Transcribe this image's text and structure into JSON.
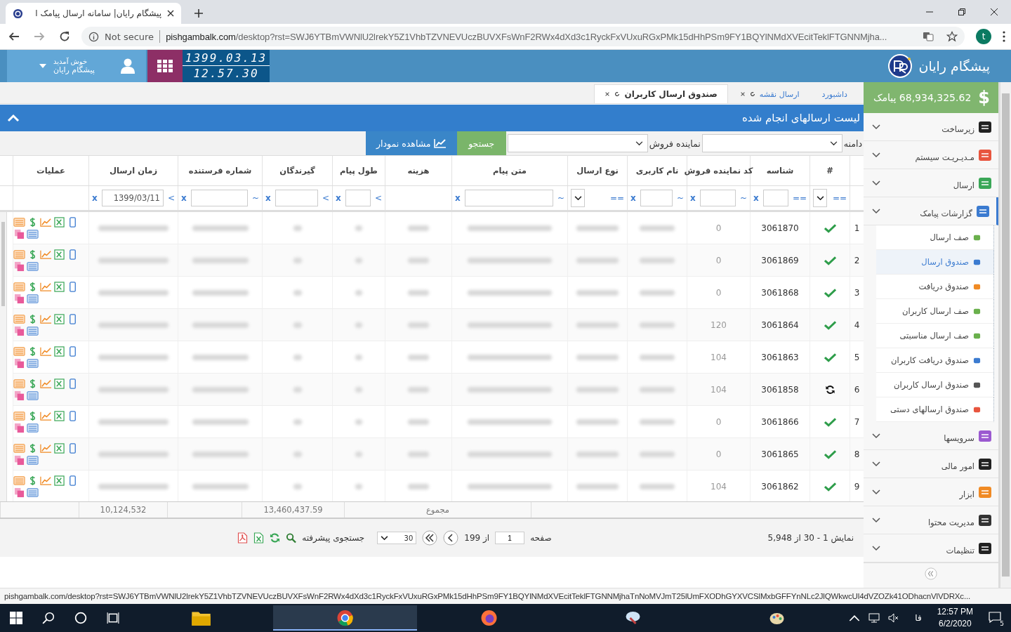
{
  "browser": {
    "tab_title": "پیشگام رایان| سامانه ارسال پیامک ا",
    "not_secure": "Not secure",
    "url_host": "pishgambalk.com",
    "url_path": "/desktop?rst=SWJ6YTBmVWNlU2lrekY5Z1VhbTZVNEVUczBUVXFsWnF2RWx4dXd3c1RyckFxVUxuRGxPMk15dHhPSm9FY1BQYlNMdXVEcitTeklFTGNNMjha...",
    "profile": "t",
    "status_url": "pishgambalk.com/desktop?rst=SWJ6YTBmVWNlU2lrekY5Z1VhbTZVNEVUczBUVXFsWnF2RWx4dXd3c1RyckFxVUxuRGxPMk15dHhPSm9FY1BQYlNMdXVEcitTeklFTGNNMjhaTnNoMVJmT25lUmFXODhGYXVCSlMxbGFFYnNLc2JlQWkwcUl4dVZOZk41ODhacnVlVDRXc..."
  },
  "header": {
    "brand": "پیشگام رایان",
    "date": "1399.03.13",
    "time": "12.57.30",
    "welcome": "خوش آمدید",
    "user_name": "پیشگام رایان"
  },
  "sidebar": {
    "balance_icon": "$",
    "balance": "68,934,325.62 پیامک",
    "items": [
      {
        "label": "زیرساخت",
        "expanded": false
      },
      {
        "label": "مـدیـریـت سیستم",
        "expanded": false
      },
      {
        "label": "ارسال",
        "expanded": false
      },
      {
        "label": "گزارشات پیامک",
        "expanded": true,
        "children": [
          {
            "label": "صف ارسال",
            "selected": false
          },
          {
            "label": "صندوق ارسال",
            "selected": true
          },
          {
            "label": "صندوق دریافت",
            "selected": false
          },
          {
            "label": "صف ارسال کاربران",
            "selected": false
          },
          {
            "label": "صف ارسال مناسبتی",
            "selected": false
          },
          {
            "label": "صندوق دریافت کاربران",
            "selected": false
          },
          {
            "label": "صندوق ارسال کاربران",
            "selected": false
          },
          {
            "label": "صندوق ارسالهای دستی",
            "selected": false
          }
        ]
      },
      {
        "label": "سرویسها",
        "expanded": false
      },
      {
        "label": "امور مالی",
        "expanded": false
      },
      {
        "label": "ابزار",
        "expanded": false
      },
      {
        "label": "مدیریت محتوا",
        "expanded": false
      },
      {
        "label": "تنظیمات",
        "expanded": false
      }
    ]
  },
  "tabs": [
    {
      "label": "داشبورد",
      "selected": false,
      "closable": false
    },
    {
      "label": "ارسال نقشه",
      "selected": false,
      "closable": true
    },
    {
      "label": "صندوق ارسال کاربران",
      "selected": true,
      "closable": true
    }
  ],
  "panel": {
    "title": "لیست ارسالهای انجام شده",
    "domain_label": "دامنه",
    "rep_label": "نماینده فروش",
    "search_button": "جستجو",
    "chart_button": "مشاهده نمودار"
  },
  "table": {
    "columns": [
      {},
      {
        "label": "#",
        "op": "==",
        "kind": "select"
      },
      {
        "label": "شناسه",
        "op": "==",
        "kind": "input",
        "clear": "x"
      },
      {
        "label": "کد نماینده فروش",
        "op": "~",
        "kind": "input",
        "clear": "x"
      },
      {
        "label": "نام کاربری",
        "op": "~",
        "kind": "input",
        "clear": "x"
      },
      {
        "label": "نوع ارسال",
        "op": "==",
        "kind": "select"
      },
      {
        "label": "متن پیام",
        "op": "~",
        "kind": "input",
        "clear": "x"
      },
      {
        "label": "هزینه"
      },
      {
        "label": "طول پیام",
        "op": ">",
        "kind": "input",
        "clear": "x"
      },
      {
        "label": "گیرندگان",
        "op": ">",
        "kind": "input",
        "clear": "x"
      },
      {
        "label": "شماره فرستنده",
        "op": "~",
        "kind": "input",
        "clear": "x"
      },
      {
        "label": "زمان ارسال",
        "op": ">",
        "kind": "input",
        "clear": "x",
        "value": "1399/03/11"
      },
      {
        "label": "عملیات"
      }
    ],
    "rows": [
      {
        "number": "1",
        "delivered": true,
        "id": "3061870",
        "rep_code": "0"
      },
      {
        "number": "2",
        "delivered": true,
        "id": "3061869",
        "rep_code": "0"
      },
      {
        "number": "3",
        "delivered": true,
        "id": "3061868",
        "rep_code": "0"
      },
      {
        "number": "4",
        "delivered": true,
        "id": "3061864",
        "rep_code": "120"
      },
      {
        "number": "5",
        "delivered": true,
        "id": "3061863",
        "rep_code": "104"
      },
      {
        "number": "6",
        "delivered": false,
        "id": "3061858",
        "rep_code": "104"
      },
      {
        "number": "7",
        "delivered": true,
        "id": "3061866",
        "rep_code": "0"
      },
      {
        "number": "8",
        "delivered": true,
        "id": "3061865",
        "rep_code": "0"
      },
      {
        "number": "9",
        "delivered": true,
        "id": "3061862",
        "rep_code": "104"
      }
    ],
    "totals": {
      "label": "مجموع",
      "cost": "13,460,437.59",
      "recipients": "10,124,532"
    }
  },
  "pager": {
    "summary": "نمایش 1 - 30 از 5,948",
    "page_label": "صفحه",
    "page": "1",
    "of": "از 199",
    "page_size": "30",
    "advanced_search": "جستجوی پیشرفته"
  },
  "taskbar": {
    "lang": "فا",
    "time": "12:57 PM",
    "date": "6/2/2020",
    "notifications": "5"
  }
}
